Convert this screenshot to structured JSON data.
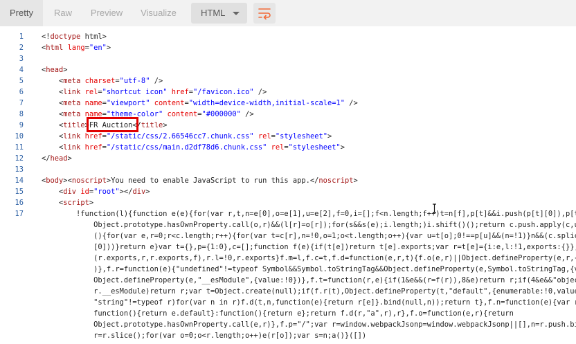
{
  "toolbar": {
    "tabs": [
      "Pretty",
      "Raw",
      "Preview",
      "Visualize"
    ],
    "language": "HTML",
    "wrap_icon": "wrap-lines-icon"
  },
  "colors": {
    "tag": "#a31515",
    "attr": "#e50000",
    "string": "#0000ff",
    "line_number": "#2b5fa4",
    "highlight": "#e00000"
  },
  "code": {
    "line_numbers": [
      "1",
      "2",
      "3",
      "4",
      "5",
      "6",
      "7",
      "8",
      "9",
      "10",
      "11",
      "12",
      "13",
      "14",
      "15",
      "16",
      "17"
    ],
    "lines": [
      "<!doctype html>",
      "<html lang=\"en\">",
      "",
      "<head>",
      "    <meta charset=\"utf-8\" />",
      "    <link rel=\"shortcut icon\" href=\"/favicon.ico\" />",
      "    <meta name=\"viewport\" content=\"width=device-width,initial-scale=1\" />",
      "    <meta name=\"theme-color\" content=\"#000000\" />",
      "    <title>FR Auction</title>",
      "    <link href=\"/static/css/2.66546cc7.chunk.css\" rel=\"stylesheet\">",
      "    <link href=\"/static/css/main.d2df78d6.chunk.css\" rel=\"stylesheet\">",
      "</head>",
      "",
      "<body><noscript>You need to enable JavaScript to run this app.</noscript>",
      "    <div id=\"root\"></div>",
      "    <script>",
      "        !function(l){function e(e){for(var r,t,n=e[0],o=e[1],u=e[2],f=0,i=[];f<n.length;f++)t=n[f],p[t]&&i.push(p[t][0]),p[t]=0;for(r in o)",
      "            Object.prototype.hasOwnProperty.call(o,r)&&(l[r]=o[r]);for(s&&s(e);i.length;)i.shift()();return c.push.apply(c,u||[]),t()}function t",
      "            (){for(var e,r=0;r<c.length;r++){for(var t=c[r],n=!0,o=1;o<t.length;o++){var u=t[o];0!==p[u]&&(n=!1)}n&&(c.splice(r--,1),e=f(f.s=t",
      "            [0]))}return e}var t={},p={1:0},c=[];function f(e){if(t[e])return t[e].exports;var r=t[e]={i:e,l:!1,exports:{}};return l[e].call",
      "            (r.exports,r,r.exports,f),r.l=!0,r.exports}f.m=l,f.c=t,f.d=function(e,r,t){f.o(e,r)||Object.defineProperty(e,r,{enumerable:!0,get:t}",
      "            )},f.r=function(e){\"undefined\"!=typeof Symbol&&Symbol.toStringTag&&Object.defineProperty(e,Symbol.toStringTag,{value:\"Module\"}),",
      "            Object.defineProperty(e,\"__esModule\",{value:!0})},f.t=function(r,e){if(1&e&&(r=f(r)),8&e)return r;if(4&e&&\"object\"==typeof r&&r&&",
      "            r.__esModule)return r;var t=Object.create(null);if(f.r(t),Object.defineProperty(t,\"default\",{enumerable:!0,value:r}),2&e&&",
      "            \"string\"!=typeof r)for(var n in r)f.d(t,n,function(e){return r[e]}.bind(null,n));return t},f.n=function(e){var r=e&&e.__esModule?",
      "            function(){return e.default}:function(){return e};return f.d(r,\"a\",r),r},f.o=function(e,r){return",
      "            Object.prototype.hasOwnProperty.call(e,r)},f.p=\"/\";var r=window.webpackJsonp=window.webpackJsonp||[],n=r.push.bind(r);r.push=e,",
      "            r=r.slice();for(var o=0;o<r.length;o++)e(r[o]);var s=n;a()}([])"
    ]
  }
}
